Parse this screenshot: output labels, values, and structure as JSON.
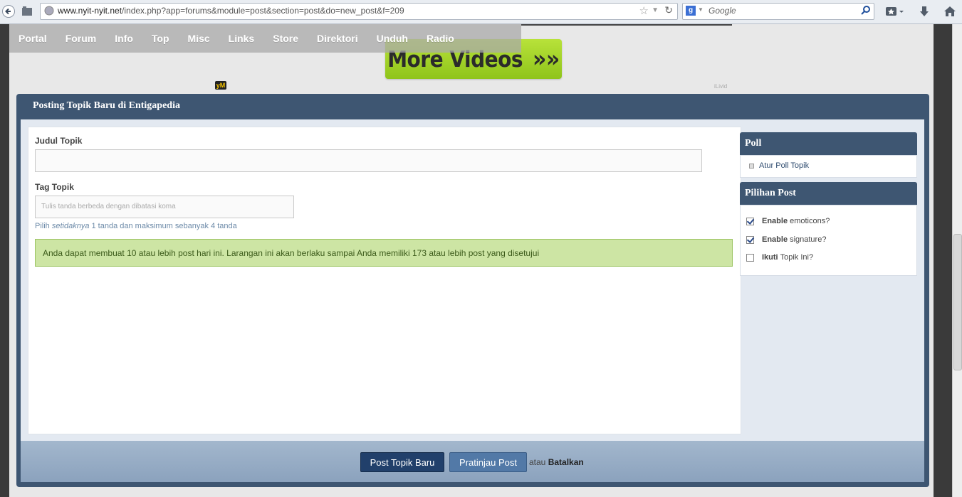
{
  "browser": {
    "url_host": "www.nyit-nyit.net",
    "url_path": "/index.php?app=forums&module=post&section=post&do=new_post&f=209",
    "search_placeholder": "Google"
  },
  "nav": {
    "items": [
      "Portal",
      "Forum",
      "Info",
      "Top",
      "Misc",
      "Links",
      "Store",
      "Direktori",
      "Unduh",
      "Radio"
    ]
  },
  "ad": {
    "text": "More Videos",
    "arrows": "»»",
    "badge": "yM",
    "provider": "iLivid"
  },
  "panel": {
    "title": "Posting Topik Baru di Entigapedia",
    "topic_title_label": "Judul Topik",
    "topic_title_value": "",
    "tag_label": "Tag Topik",
    "tag_placeholder": "Tulis tanda berbeda dengan dibatasi koma",
    "hint_pre": "Pilih ",
    "hint_em": "setidaknya",
    "hint_post": " 1 tanda dan maksimum sebanyak 4 tanda",
    "message": "Anda dapat membuat 10 atau lebih post hari ini. Larangan ini akan berlaku sampai Anda memiliki 173 atau lebih post yang disetujui"
  },
  "sidebar": {
    "poll_heading": "Poll",
    "poll_link": "Atur Poll Topik",
    "options_heading": "Pilihan Post",
    "options": [
      {
        "bold": "Enable",
        "text": "emoticons?",
        "checked": true
      },
      {
        "bold": "Enable",
        "text": "signature?",
        "checked": true
      },
      {
        "bold": "Ikuti",
        "text": "Topik Ini?",
        "checked": false
      }
    ]
  },
  "footer": {
    "submit_label": "Post Topik Baru",
    "preview_label": "Pratinjau Post",
    "or_text": "atau",
    "cancel_label": "Batalkan"
  }
}
